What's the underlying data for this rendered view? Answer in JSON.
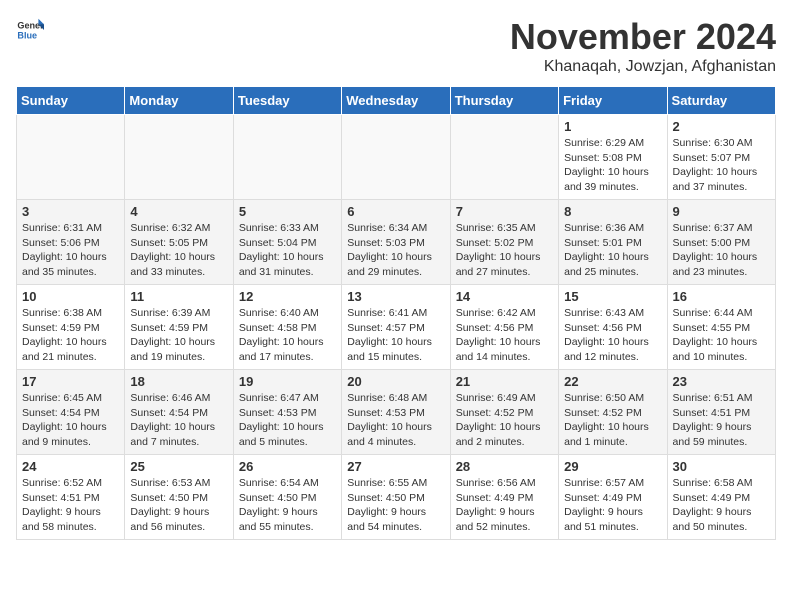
{
  "header": {
    "logo_general": "General",
    "logo_blue": "Blue",
    "month": "November 2024",
    "location": "Khanaqah, Jowzjan, Afghanistan"
  },
  "days_of_week": [
    "Sunday",
    "Monday",
    "Tuesday",
    "Wednesday",
    "Thursday",
    "Friday",
    "Saturday"
  ],
  "weeks": [
    [
      {
        "day": "",
        "info": ""
      },
      {
        "day": "",
        "info": ""
      },
      {
        "day": "",
        "info": ""
      },
      {
        "day": "",
        "info": ""
      },
      {
        "day": "",
        "info": ""
      },
      {
        "day": "1",
        "info": "Sunrise: 6:29 AM\nSunset: 5:08 PM\nDaylight: 10 hours\nand 39 minutes."
      },
      {
        "day": "2",
        "info": "Sunrise: 6:30 AM\nSunset: 5:07 PM\nDaylight: 10 hours\nand 37 minutes."
      }
    ],
    [
      {
        "day": "3",
        "info": "Sunrise: 6:31 AM\nSunset: 5:06 PM\nDaylight: 10 hours\nand 35 minutes."
      },
      {
        "day": "4",
        "info": "Sunrise: 6:32 AM\nSunset: 5:05 PM\nDaylight: 10 hours\nand 33 minutes."
      },
      {
        "day": "5",
        "info": "Sunrise: 6:33 AM\nSunset: 5:04 PM\nDaylight: 10 hours\nand 31 minutes."
      },
      {
        "day": "6",
        "info": "Sunrise: 6:34 AM\nSunset: 5:03 PM\nDaylight: 10 hours\nand 29 minutes."
      },
      {
        "day": "7",
        "info": "Sunrise: 6:35 AM\nSunset: 5:02 PM\nDaylight: 10 hours\nand 27 minutes."
      },
      {
        "day": "8",
        "info": "Sunrise: 6:36 AM\nSunset: 5:01 PM\nDaylight: 10 hours\nand 25 minutes."
      },
      {
        "day": "9",
        "info": "Sunrise: 6:37 AM\nSunset: 5:00 PM\nDaylight: 10 hours\nand 23 minutes."
      }
    ],
    [
      {
        "day": "10",
        "info": "Sunrise: 6:38 AM\nSunset: 4:59 PM\nDaylight: 10 hours\nand 21 minutes."
      },
      {
        "day": "11",
        "info": "Sunrise: 6:39 AM\nSunset: 4:59 PM\nDaylight: 10 hours\nand 19 minutes."
      },
      {
        "day": "12",
        "info": "Sunrise: 6:40 AM\nSunset: 4:58 PM\nDaylight: 10 hours\nand 17 minutes."
      },
      {
        "day": "13",
        "info": "Sunrise: 6:41 AM\nSunset: 4:57 PM\nDaylight: 10 hours\nand 15 minutes."
      },
      {
        "day": "14",
        "info": "Sunrise: 6:42 AM\nSunset: 4:56 PM\nDaylight: 10 hours\nand 14 minutes."
      },
      {
        "day": "15",
        "info": "Sunrise: 6:43 AM\nSunset: 4:56 PM\nDaylight: 10 hours\nand 12 minutes."
      },
      {
        "day": "16",
        "info": "Sunrise: 6:44 AM\nSunset: 4:55 PM\nDaylight: 10 hours\nand 10 minutes."
      }
    ],
    [
      {
        "day": "17",
        "info": "Sunrise: 6:45 AM\nSunset: 4:54 PM\nDaylight: 10 hours\nand 9 minutes."
      },
      {
        "day": "18",
        "info": "Sunrise: 6:46 AM\nSunset: 4:54 PM\nDaylight: 10 hours\nand 7 minutes."
      },
      {
        "day": "19",
        "info": "Sunrise: 6:47 AM\nSunset: 4:53 PM\nDaylight: 10 hours\nand 5 minutes."
      },
      {
        "day": "20",
        "info": "Sunrise: 6:48 AM\nSunset: 4:53 PM\nDaylight: 10 hours\nand 4 minutes."
      },
      {
        "day": "21",
        "info": "Sunrise: 6:49 AM\nSunset: 4:52 PM\nDaylight: 10 hours\nand 2 minutes."
      },
      {
        "day": "22",
        "info": "Sunrise: 6:50 AM\nSunset: 4:52 PM\nDaylight: 10 hours\nand 1 minute."
      },
      {
        "day": "23",
        "info": "Sunrise: 6:51 AM\nSunset: 4:51 PM\nDaylight: 9 hours\nand 59 minutes."
      }
    ],
    [
      {
        "day": "24",
        "info": "Sunrise: 6:52 AM\nSunset: 4:51 PM\nDaylight: 9 hours\nand 58 minutes."
      },
      {
        "day": "25",
        "info": "Sunrise: 6:53 AM\nSunset: 4:50 PM\nDaylight: 9 hours\nand 56 minutes."
      },
      {
        "day": "26",
        "info": "Sunrise: 6:54 AM\nSunset: 4:50 PM\nDaylight: 9 hours\nand 55 minutes."
      },
      {
        "day": "27",
        "info": "Sunrise: 6:55 AM\nSunset: 4:50 PM\nDaylight: 9 hours\nand 54 minutes."
      },
      {
        "day": "28",
        "info": "Sunrise: 6:56 AM\nSunset: 4:49 PM\nDaylight: 9 hours\nand 52 minutes."
      },
      {
        "day": "29",
        "info": "Sunrise: 6:57 AM\nSunset: 4:49 PM\nDaylight: 9 hours\nand 51 minutes."
      },
      {
        "day": "30",
        "info": "Sunrise: 6:58 AM\nSunset: 4:49 PM\nDaylight: 9 hours\nand 50 minutes."
      }
    ]
  ]
}
